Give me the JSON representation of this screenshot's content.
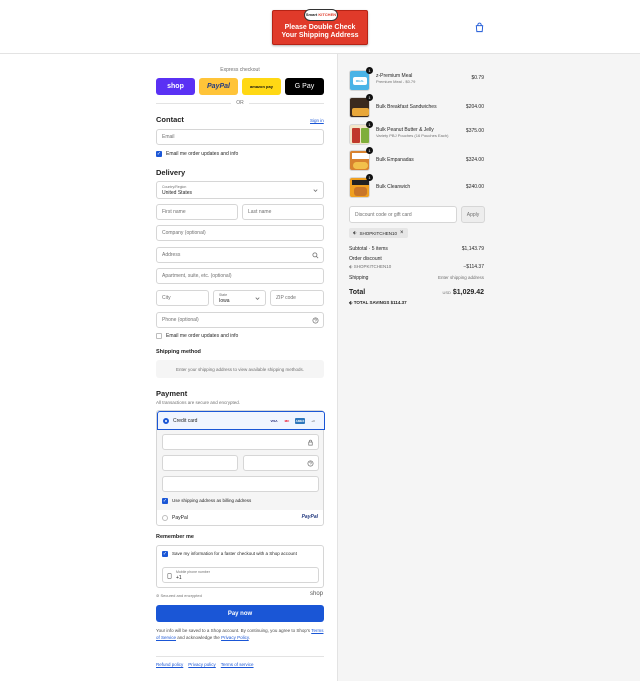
{
  "banner": {
    "logo_prefix": "Smart",
    "logo_main": "KITCHEN",
    "line1": "Please Double Check",
    "line2": "Your Shipping Address"
  },
  "express": {
    "title": "Express checkout",
    "shop": "shop",
    "paypal": "PayPal",
    "amazon": "amazon pay",
    "gpay": "G Pay",
    "or": "OR"
  },
  "contact": {
    "heading": "Contact",
    "sign_in": "Sign in",
    "email_placeholder": "Email",
    "email_opt_in": "Email me order updates and info"
  },
  "delivery": {
    "heading": "Delivery",
    "country_label": "Country/Region",
    "country_value": "United States",
    "first_name": "First name",
    "last_name": "Last name",
    "company": "Company (optional)",
    "address": "Address",
    "apartment": "Apartment, suite, etc. (optional)",
    "city": "City",
    "state_label": "State",
    "state_value": "Iowa",
    "zip": "ZIP code",
    "phone": "Phone (optional)",
    "email_opt_in": "Email me order updates and info"
  },
  "shipping_method": {
    "heading": "Shipping method",
    "message": "Enter your shipping address to view available shipping methods."
  },
  "payment": {
    "heading": "Payment",
    "subtitle": "All transactions are secure and encrypted.",
    "credit_card": "Credit card",
    "card_brands": [
      "VISA",
      "MC",
      "AMEX",
      "+3"
    ],
    "billing_same": "Use shipping address as billing address",
    "paypal": "PayPal",
    "paypal_logo": "PayPal"
  },
  "remember": {
    "heading": "Remember me",
    "save_info": "Save my information for a faster checkout with a Shop account",
    "mobile_label": "Mobile phone number",
    "mobile_value": "+1",
    "secure": "Secured and encrypted",
    "shop_logo": "shop"
  },
  "pay_now": "Pay now",
  "fine_print": {
    "text1": "Your info will be saved to a Shop account. By continuing, you agree to Shop's",
    "tos": "Terms of Service",
    "text2": " and acknowledge the ",
    "privacy": "Privacy Policy",
    "text3": "."
  },
  "footer": {
    "refund": "Refund policy",
    "privacy": "Privacy policy",
    "terms": "Terms of service"
  },
  "order": {
    "items": [
      {
        "name": "z-Premium Meal",
        "sub": "Premium Meal - $0.79",
        "qty": "1",
        "price": "$0.79"
      },
      {
        "name": "Bulk Breakfast Sandwiches",
        "sub": "",
        "qty": "1",
        "price": "$204.00"
      },
      {
        "name": "Bulk Peanut Butter & Jelly",
        "sub": "Variety PBJ Pouches (16 Pouches Each)",
        "qty": "1",
        "price": "$375.00"
      },
      {
        "name": "Bulk Empanadas",
        "sub": "",
        "qty": "1",
        "price": "$324.00"
      },
      {
        "name": "Bulk Cleanwich",
        "sub": "",
        "qty": "1",
        "price": "$240.00"
      }
    ],
    "discount_placeholder": "Discount code or gift card",
    "apply": "Apply",
    "applied_code": "SHOPKITCHEN10",
    "subtotal_label": "Subtotal · 5 items",
    "subtotal_value": "$1,143.79",
    "order_discount_label": "Order discount",
    "discount_code": "SHOPKITCHEN10",
    "discount_value": "−$114.37",
    "shipping_label": "Shipping",
    "shipping_value": "Enter shipping address",
    "total_label": "Total",
    "currency": "USD",
    "total_value": "$1,029.42",
    "savings_label": "TOTAL SAVINGS",
    "savings_value": "$114.37"
  }
}
